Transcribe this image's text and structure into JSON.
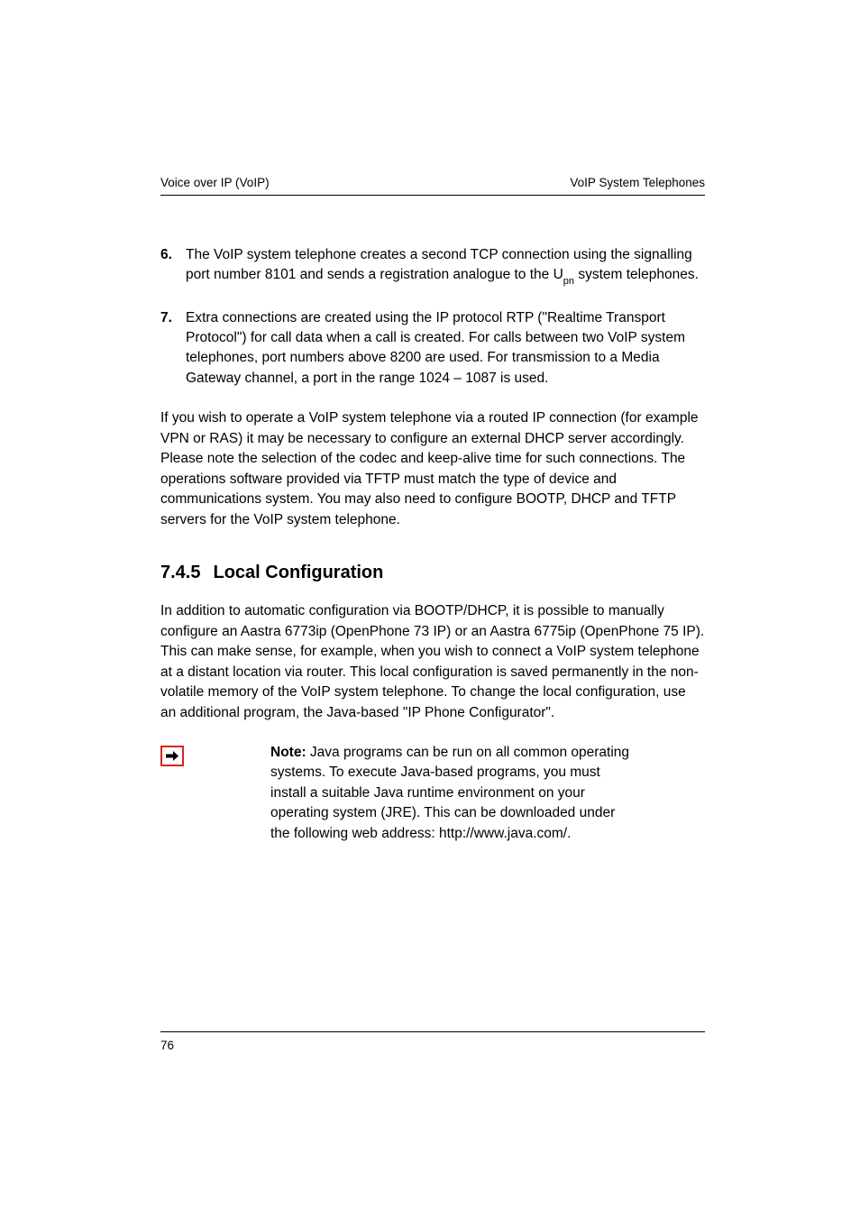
{
  "header": {
    "left": "Voice over IP (VoIP)",
    "right": "VoIP System Telephones"
  },
  "list": {
    "item6": {
      "num": "6.",
      "text_a": "The VoIP system telephone creates a second TCP connection using the signalling port number 8101 and sends a registration analogue to the U",
      "sub": "pn",
      "text_b": " system telephones."
    },
    "item7": {
      "num": "7.",
      "text": "Extra connections are created using the IP protocol RTP (\"Realtime Transport Protocol\") for call data when a call is created. For calls between two VoIP system telephones, port numbers above 8200 are used. For transmission to a Media Gateway channel, a port in the range 1024 – 1087 is used."
    }
  },
  "para_routed": "If you wish to operate a VoIP system telephone via a routed IP connection (for example VPN or RAS) it may be necessary to configure an external DHCP server accordingly. Please note the selection of the codec and keep-alive time for such connections. The operations software provided via TFTP must match the type of device and communications system. You may also need to configure BOOTP, DHCP and TFTP servers for the VoIP system telephone.",
  "section": {
    "num": "7.4.5",
    "title": "Local Configuration"
  },
  "para_local": "In addition to automatic configuration via BOOTP/DHCP, it is possible to manually configure an Aastra 6773ip (OpenPhone 73 IP) or an Aastra 6775ip (OpenPhone 75 IP). This can make sense, for example, when you wish to connect a VoIP system telephone at a distant location via router. This local configuration is saved permanently in the non-volatile memory of the VoIP system telephone. To change the local configuration, use an additional program, the Java-based \"IP Phone Configurator\".",
  "note": {
    "label": "Note:",
    "text": "  Java programs can be run on all common operating systems. To execute Java-based programs, you must install a suitable Java runtime environment on your operating system (JRE). This can be downloaded under the following web address: http://www.java.com/."
  },
  "footer": {
    "page": "76"
  }
}
